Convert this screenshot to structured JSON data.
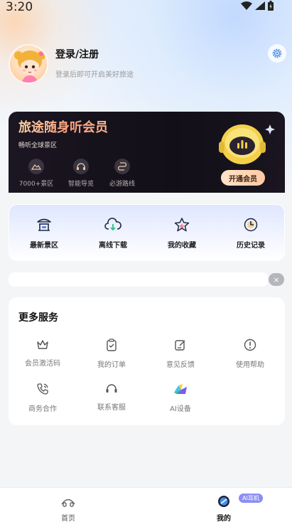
{
  "status_bar": {
    "time": "3:20"
  },
  "profile": {
    "title": "登录/注册",
    "subtitle": "登录后即可开启美好旅途"
  },
  "member_card": {
    "title": "旅途随身听会员",
    "subtitle": "畅听全球景区",
    "features": [
      {
        "label": "7000+景区",
        "icon": "mountain-icon"
      },
      {
        "label": "智能导览",
        "icon": "headphone-icon"
      },
      {
        "label": "必游路线",
        "icon": "route-icon"
      }
    ],
    "cta": "开通会员"
  },
  "quick_actions": [
    {
      "label": "最新景区",
      "icon": "pavilion-icon"
    },
    {
      "label": "离线下载",
      "icon": "cloud-download-icon"
    },
    {
      "label": "我的收藏",
      "icon": "star-icon"
    },
    {
      "label": "历史记录",
      "icon": "clock-icon"
    }
  ],
  "banner": {
    "close": "×"
  },
  "services": {
    "title": "更多服务",
    "items": [
      {
        "label": "会员激活码",
        "icon": "crown-icon"
      },
      {
        "label": "我的订单",
        "icon": "clipboard-icon"
      },
      {
        "label": "意见反馈",
        "icon": "edit-icon"
      },
      {
        "label": "使用帮助",
        "icon": "info-icon"
      },
      {
        "label": "商务合作",
        "icon": "phone-icon"
      },
      {
        "label": "联系客服",
        "icon": "headset-icon"
      },
      {
        "label": "AI设备",
        "icon": "ai-device-icon"
      }
    ]
  },
  "tabbar": {
    "items": [
      {
        "label": "首页",
        "icon": "home-icon",
        "active": false
      },
      {
        "label": "我的",
        "icon": "me-icon",
        "active": true
      }
    ],
    "badge": "AI耳机"
  },
  "colors": {
    "accent": "#4a8fe7",
    "member_gold": "#ffb88e",
    "card_dark": "#15111a"
  }
}
